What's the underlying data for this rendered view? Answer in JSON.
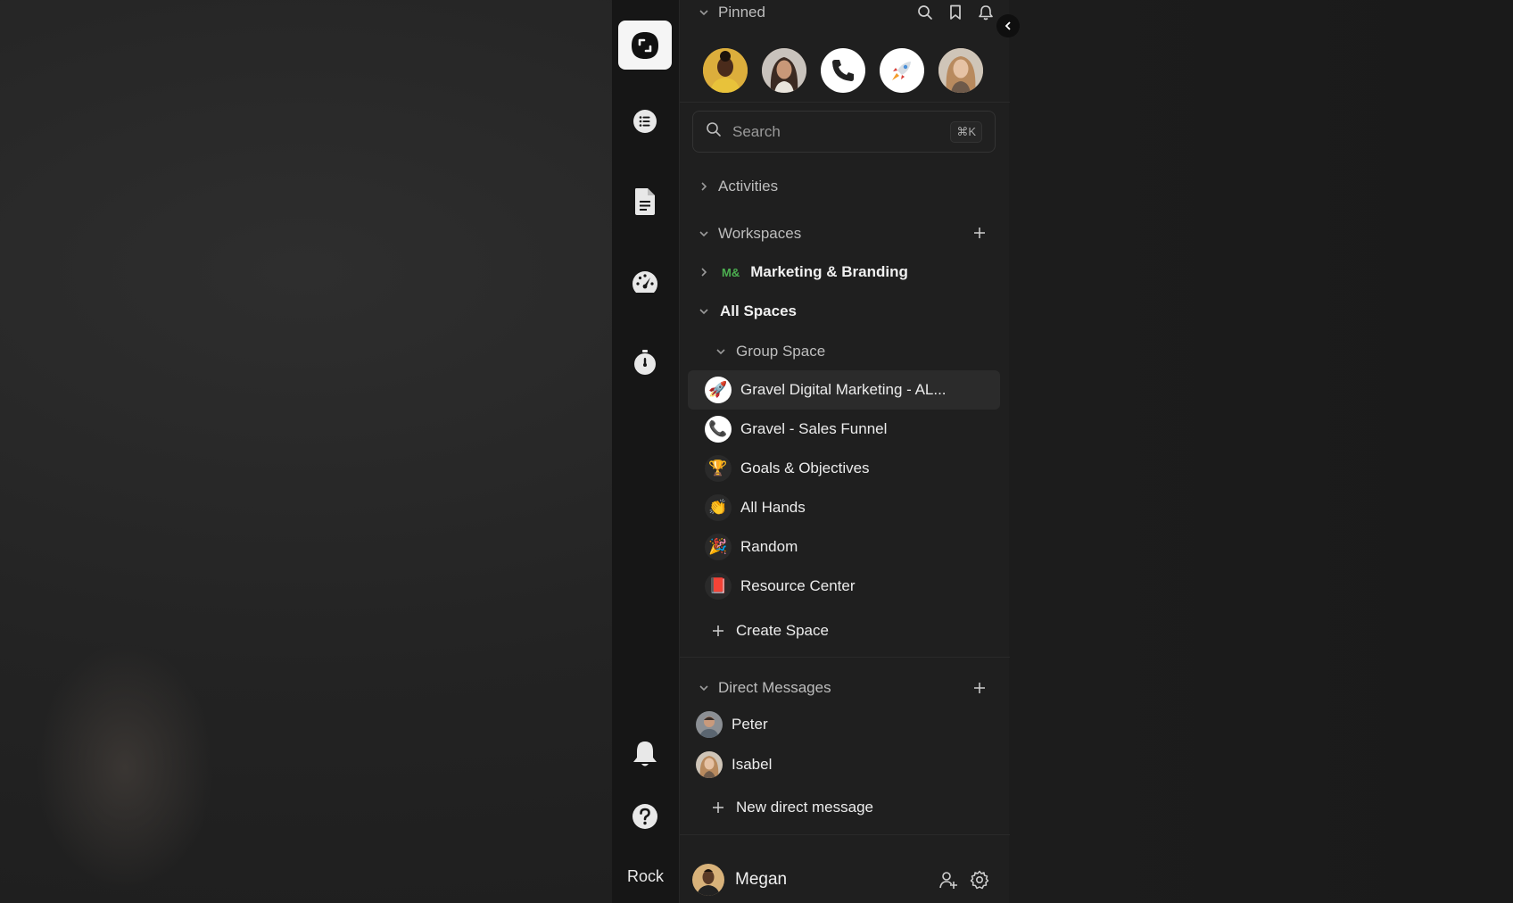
{
  "rail": {
    "items": [
      {
        "name": "logo"
      },
      {
        "name": "list-icon"
      },
      {
        "name": "document-icon"
      },
      {
        "name": "dashboard-gauge-icon"
      },
      {
        "name": "timer-icon"
      },
      {
        "name": "bell-icon"
      },
      {
        "name": "help-icon"
      }
    ],
    "label": "Rock"
  },
  "pinned": {
    "title": "Pinned",
    "actions": [
      "search-icon",
      "bookmark-icon",
      "bell-icon"
    ],
    "avatars": [
      {
        "name": "pinned-avatar-person-1",
        "bg": "#d9a93a"
      },
      {
        "name": "pinned-avatar-person-2",
        "bg": "#8a6c5c"
      },
      {
        "name": "pinned-avatar-phone",
        "bg": "#ffffff"
      },
      {
        "name": "pinned-avatar-rocket",
        "bg": "#ffffff"
      },
      {
        "name": "pinned-avatar-person-3",
        "bg": "#b99a7e"
      }
    ]
  },
  "search": {
    "placeholder": "Search",
    "shortcut": "⌘K"
  },
  "sections": {
    "activities": "Activities",
    "workspaces": "Workspaces",
    "workspace_item": {
      "badge": "M&",
      "label": "Marketing & Branding"
    },
    "all_spaces": "All Spaces",
    "group_space": "Group Space",
    "spaces": [
      {
        "label": "Gravel Digital Marketing - AL...",
        "icon": "🚀",
        "active": true
      },
      {
        "label": "Gravel - Sales Funnel",
        "icon": "📞",
        "active": false
      },
      {
        "label": "Goals & Objectives",
        "icon": "🏆",
        "active": false
      },
      {
        "label": "All Hands",
        "icon": "👏",
        "active": false
      },
      {
        "label": "Random",
        "icon": "🎉",
        "active": false
      },
      {
        "label": "Resource Center",
        "icon": "📕",
        "active": false
      }
    ],
    "create_space": "Create Space",
    "direct_messages": "Direct Messages",
    "dms": [
      {
        "label": "Peter"
      },
      {
        "label": "Isabel"
      }
    ],
    "new_dm": "New direct message"
  },
  "footer": {
    "user": "Megan"
  },
  "colors": {
    "accent_badge": "#4caf50",
    "panel_bg": "#1f1f1f",
    "rail_bg": "#161616"
  }
}
